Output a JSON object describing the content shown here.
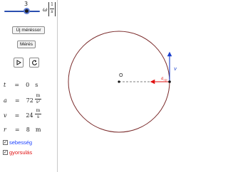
{
  "slider": {
    "value": "3",
    "omega_symbol": "ω",
    "unit_top": "1",
    "unit_bottom": "s",
    "level_fraction": 0.6
  },
  "buttons": {
    "new_measurement": "Új méréssor",
    "measure": "Mérés"
  },
  "controls": {
    "play_icon": "play-icon",
    "reset_icon": "reset-icon"
  },
  "variables": {
    "t": {
      "symbol": "t",
      "eq": "=",
      "value": "0",
      "unit": "s"
    },
    "a": {
      "symbol": "a",
      "eq": "=",
      "value": "72",
      "unit_top": "m",
      "unit_bottom": "s²"
    },
    "v": {
      "symbol": "v",
      "eq": "=",
      "value": "24",
      "unit_top": "m",
      "unit_bottom": "s"
    },
    "r": {
      "symbol": "r",
      "eq": "=",
      "value": "8",
      "unit": "m"
    }
  },
  "checkboxes": [
    {
      "label": "sebesség",
      "checked": true,
      "color": "#1a3fff"
    },
    {
      "label": "gyorsulás",
      "checked": true,
      "color": "#e01010"
    }
  ],
  "canvas": {
    "center_label": "O",
    "velocity_label": "v",
    "acceleration_label": "a",
    "acceleration_sub": "cp",
    "circle_color": "#7a2a2a",
    "velocity_color": "#1a3fcc",
    "acceleration_color": "#e01010"
  }
}
